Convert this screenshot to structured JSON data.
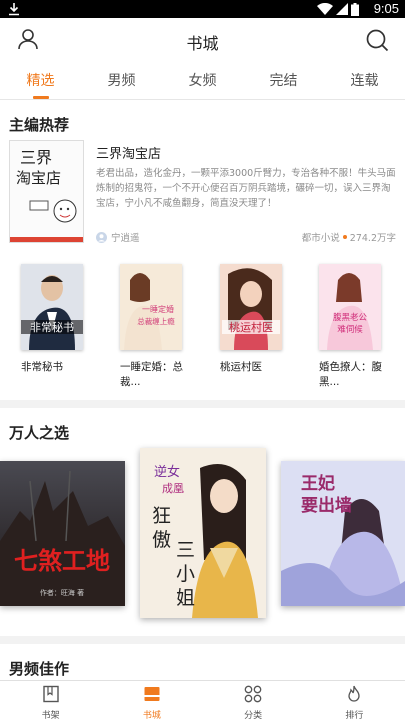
{
  "status": {
    "time": "9:05"
  },
  "header": {
    "title": "书城"
  },
  "tabs": [
    "精选",
    "男频",
    "女频",
    "完结",
    "连载"
  ],
  "featured_section": {
    "title": "主编热荐",
    "book": {
      "title": "三界淘宝店",
      "cover_text": "三界淘宝店",
      "description": "老君出品，造化金丹，一颗平添3000斤臂力，专治各种不服！牛头马面炼制的招鬼符，一个不开心便召百万阴兵踏境，碾碎一切，误入三界淘宝店，宁小凡不咸鱼翻身，简直没天理了！",
      "author": "宁逍遥",
      "category": "都市小说",
      "word_count": "274.2万字"
    },
    "row": [
      {
        "name": "非常秘书",
        "cover_text": "非常秘书",
        "color": "#2b3c5a"
      },
      {
        "name": "一睡定婚：总裁...",
        "cover_text": "一睡定婚 总裁缠上瘾",
        "color": "#f2d9c4"
      },
      {
        "name": "桃运村医",
        "cover_text": "桃运村医",
        "color": "#e8b9a8"
      },
      {
        "name": "婚色撩人：腹黑...",
        "cover_text": "腹黑老公 难伺候",
        "color": "#f3c2d3"
      }
    ]
  },
  "wanren_section": {
    "title": "万人之选",
    "books": [
      {
        "cover_text": "七煞工地",
        "color": "#3a2622"
      },
      {
        "cover_text": "逆女成凰 狂傲三小姐",
        "color": "#f4ede2"
      },
      {
        "cover_text": "王妃要出墙",
        "color": "#cfd3ee"
      }
    ]
  },
  "male_section": {
    "title": "男频佳作"
  },
  "tabbar": [
    {
      "label": "书架",
      "icon": "bookshelf-icon"
    },
    {
      "label": "书城",
      "icon": "bookstore-icon"
    },
    {
      "label": "分类",
      "icon": "category-icon"
    },
    {
      "label": "排行",
      "icon": "ranking-flame-icon"
    }
  ],
  "colors": {
    "accent": "#f07a1e"
  }
}
